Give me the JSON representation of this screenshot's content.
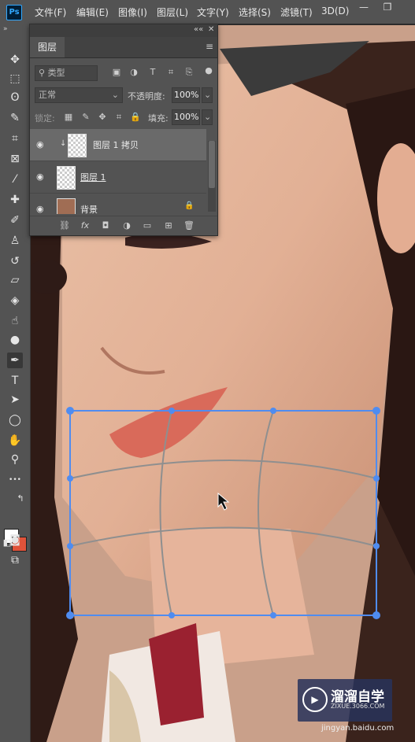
{
  "app": {
    "logo": "Ps"
  },
  "menu": {
    "items": [
      "文件(F)",
      "编辑(E)",
      "图像(I)",
      "图层(L)",
      "文字(Y)",
      "选择(S)",
      "滤镜(T)",
      "3D(D)"
    ]
  },
  "window_controls": {
    "minimize": "—",
    "restore": "❐"
  },
  "toolbar": {
    "collapse": "»",
    "tools": [
      {
        "name": "move-tool",
        "glyph": "✥"
      },
      {
        "name": "marquee-tool",
        "glyph": "⬚"
      },
      {
        "name": "lasso-tool",
        "glyph": "ʘ"
      },
      {
        "name": "quick-select-tool",
        "glyph": "✎"
      },
      {
        "name": "crop-tool",
        "glyph": "⌗"
      },
      {
        "name": "frame-tool",
        "glyph": "⊠"
      },
      {
        "name": "eyedropper-tool",
        "glyph": "⁄"
      },
      {
        "name": "healing-tool",
        "glyph": "✚"
      },
      {
        "name": "brush-tool",
        "glyph": "✐"
      },
      {
        "name": "stamp-tool",
        "glyph": "♙"
      },
      {
        "name": "history-brush-tool",
        "glyph": "↺"
      },
      {
        "name": "eraser-tool",
        "glyph": "▱"
      },
      {
        "name": "paint-bucket-tool",
        "glyph": "◈"
      },
      {
        "name": "smudge-tool",
        "glyph": "☝"
      },
      {
        "name": "dodge-tool",
        "glyph": "●"
      },
      {
        "name": "pen-tool",
        "glyph": "✒"
      },
      {
        "name": "type-tool",
        "glyph": "T"
      },
      {
        "name": "path-select-tool",
        "glyph": "➤"
      },
      {
        "name": "ellipse-tool",
        "glyph": "◯"
      },
      {
        "name": "hand-tool",
        "glyph": "✋"
      },
      {
        "name": "zoom-tool",
        "glyph": "⚲"
      },
      {
        "name": "more-tools",
        "glyph": "•••"
      }
    ],
    "colors": {
      "foreground": "#ffffff",
      "background": "#e0533a"
    },
    "extra": [
      {
        "name": "quick-mask-button",
        "glyph": "◙"
      },
      {
        "name": "screen-mode-button",
        "glyph": "⧉"
      }
    ]
  },
  "layers_panel": {
    "tab": "图层",
    "search_placeholder": "类型",
    "blend_mode": "正常",
    "opacity_label": "不透明度:",
    "opacity_value": "100%",
    "lock_label": "锁定:",
    "fill_label": "填充:",
    "fill_value": "100%",
    "layers": [
      {
        "name": "图层 1 拷贝",
        "selected": true
      },
      {
        "name": "图层 1",
        "selected": false
      },
      {
        "name": "背景",
        "selected": false
      }
    ],
    "footer": [
      "⛓",
      "fx",
      "◘",
      "◑",
      "▭",
      "⊞",
      "🗑"
    ]
  },
  "watermark": {
    "brand": "溜溜自学",
    "site": "ZIXUE.3066.COM",
    "secondary": "jingyan.baidu.com"
  }
}
